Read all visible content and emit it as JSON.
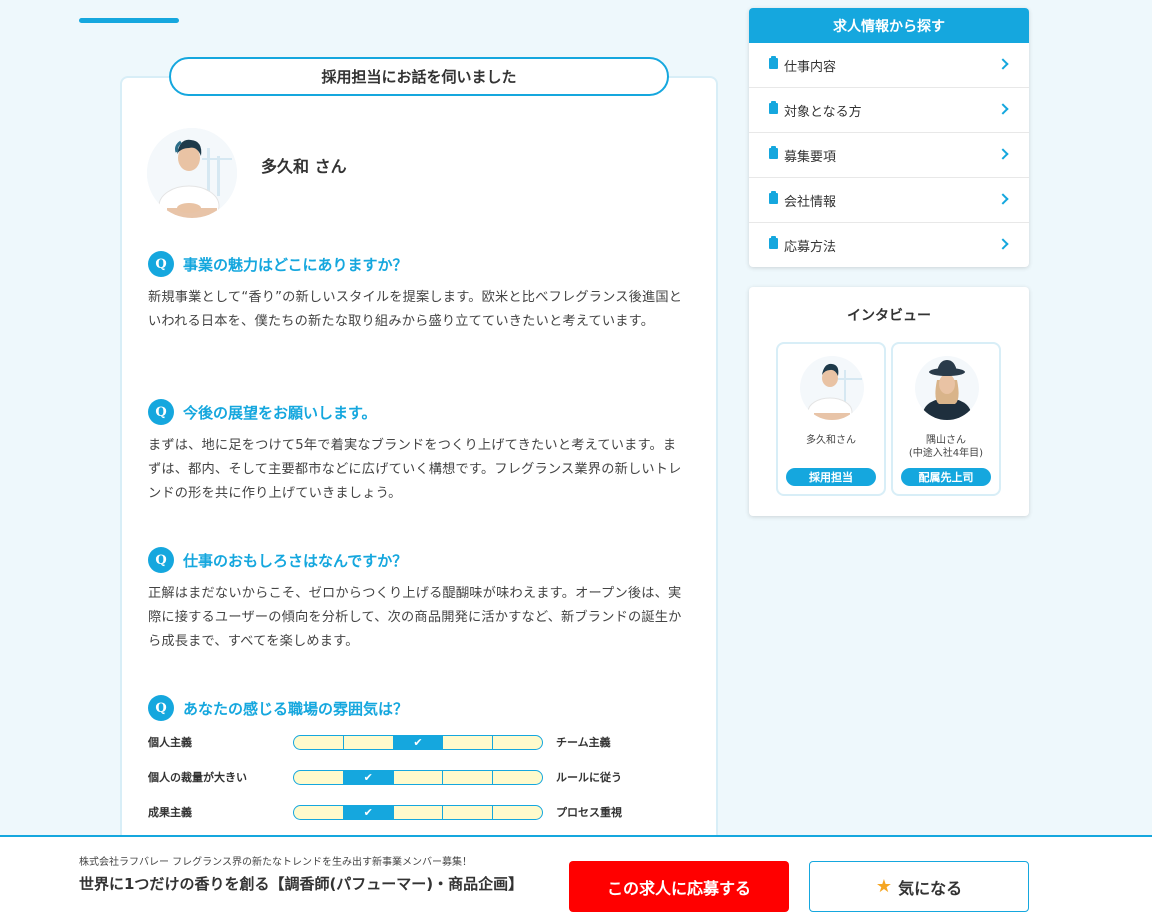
{
  "interview": {
    "heading": "採用担当にお話を伺いました",
    "person_name": "多久和 さん",
    "qas": [
      {
        "q_badge": "Q",
        "question": "事業の魅力はどこにありますか？",
        "answer": "新規事業として“香り”の新しいスタイルを提案します。欧米と比べフレグランス後進国といわれる日本を、僕たちの新たな取り組みから盛り立てていきたいと考えています。"
      },
      {
        "q_badge": "Q",
        "question": "今後の展望をお願いします。",
        "answer": "まずは、地に足をつけて5年で着実なブランドをつくり上げてきたいと考えています。まずは、都内、そして主要都市などに広げていく構想です。フレグランス業界の新しいトレンドの形を共に作り上げていきましょう。"
      },
      {
        "q_badge": "Q",
        "question": "仕事のおもしろさはなんですか？",
        "answer": "正解はまだないからこそ、ゼロからつくり上げる醍醐味が味わえます。オープン後は、実際に接するユーザーの傾向を分析して、次の商品開発に活かすなど、新ブランドの誕生から成長まで、すべてを楽しめます。"
      },
      {
        "q_badge": "Q",
        "question": "あなたの感じる職場の雰囲気は？",
        "answer": ""
      }
    ],
    "scales": [
      {
        "left": "個人主義",
        "right": "チーム主義",
        "selected": 3,
        "segments": 5
      },
      {
        "left": "個人の裁量が大きい",
        "right": "ルールに従う",
        "selected": 2,
        "segments": 5
      },
      {
        "left": "成果主義",
        "right": "プロセス重視",
        "selected": 2,
        "segments": 5
      }
    ]
  },
  "sidebar": {
    "heading": "求人情報から探す",
    "items": [
      {
        "label": "仕事内容"
      },
      {
        "label": "対象となる方"
      },
      {
        "label": "募集要項"
      },
      {
        "label": "会社情報"
      },
      {
        "label": "応募方法"
      }
    ]
  },
  "interview_box": {
    "heading": "インタビュー",
    "cards": [
      {
        "name": "多久和さん",
        "sub": "",
        "tag": "採用担当"
      },
      {
        "name": "隅山さん",
        "sub": "(中途入社4年目)",
        "tag": "配属先上司"
      }
    ]
  },
  "footer": {
    "company": "株式会社ラフバレー フレグランス界の新たなトレンドを生み出す新事業メンバー募集！",
    "job_title": "世界に1つだけの香りを創る【調香師(パフューマー)・商品企画】",
    "apply_label": "この求人に応募する",
    "fav_label": "気になる",
    "check_glyph": "✔",
    "star_glyph": "★"
  },
  "colors": {
    "accent": "#15a7de",
    "apply": "#ff0000",
    "scale_bg": "#fffacc"
  }
}
